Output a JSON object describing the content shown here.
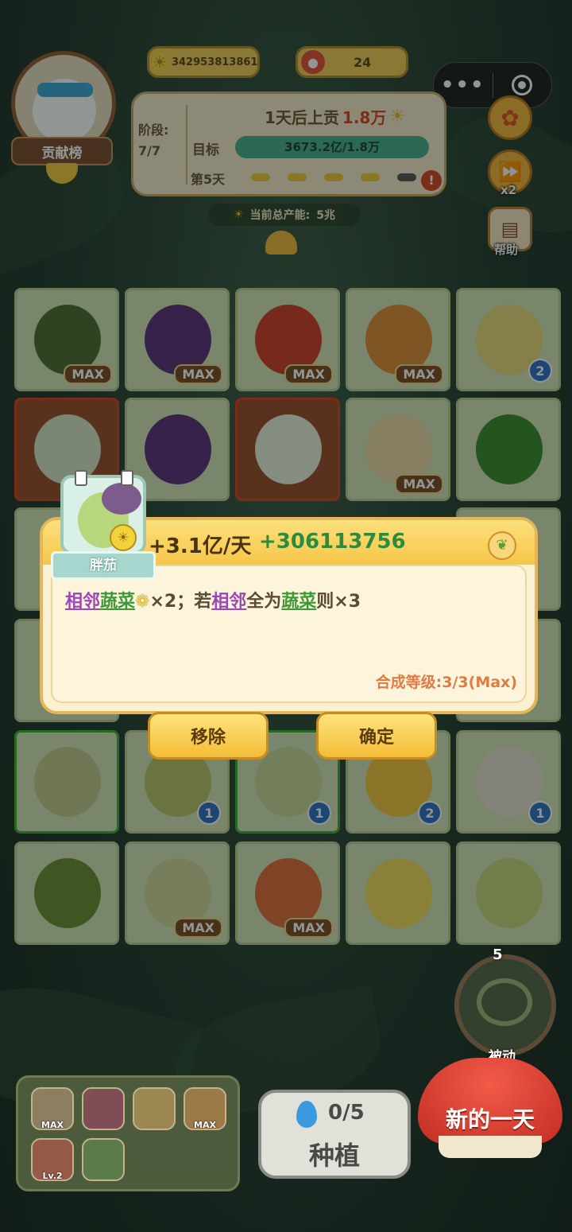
{
  "header": {
    "coins": "342953813861",
    "mushrooms": "24",
    "rank_label": "贡献榜"
  },
  "stage": {
    "label": "阶段:",
    "value": "7/7",
    "tribute_prefix": "1天后上贡",
    "tribute_amount": "1.8万",
    "target_label": "目标",
    "target_text": "3673.2亿/1.8万",
    "target_progress": 1.0,
    "day_label": "第5天",
    "total_prefix": "当前总产能:",
    "total_value": "5兆"
  },
  "side": {
    "speed_label": "x2",
    "help_label": "帮助"
  },
  "tiles": [
    {
      "badge": "MAX"
    },
    {
      "badge": "MAX"
    },
    {
      "badge": "MAX"
    },
    {
      "badge": "MAX"
    },
    {
      "badge": "2"
    },
    {
      "badge": ""
    },
    {
      "badge": ""
    },
    {
      "badge": ""
    },
    {
      "badge": "MAX"
    },
    {
      "badge": ""
    },
    {
      "badge": ""
    },
    {
      "badge": "1"
    },
    {
      "badge": "1"
    },
    {
      "badge": "2"
    },
    {
      "badge": "1"
    },
    {
      "badge": ""
    },
    {
      "badge": "MAX"
    },
    {
      "badge": "MAX"
    },
    {
      "badge": ""
    },
    {
      "badge": ""
    }
  ],
  "popup": {
    "card_name": "胖茄",
    "rate": "+3.1亿/天",
    "bonus": "+306113756",
    "desc": {
      "a1": "相邻",
      "a2": "蔬菜",
      "a3": "×2；若",
      "a4": "相邻",
      "a5": "全为",
      "a6": "蔬菜",
      "a7": "则×3"
    },
    "level_label": "合成等级:",
    "level_value": "3/3(Max)",
    "remove_button": "移除",
    "confirm_button": "确定"
  },
  "bottom": {
    "passive_count": "5",
    "passive_label": "被动",
    "tray_labels": [
      "MAX",
      "",
      "",
      "MAX",
      "Lv.2",
      ""
    ],
    "water": "0/5",
    "plant_label": "种植",
    "new_day_label": "新的一天"
  }
}
